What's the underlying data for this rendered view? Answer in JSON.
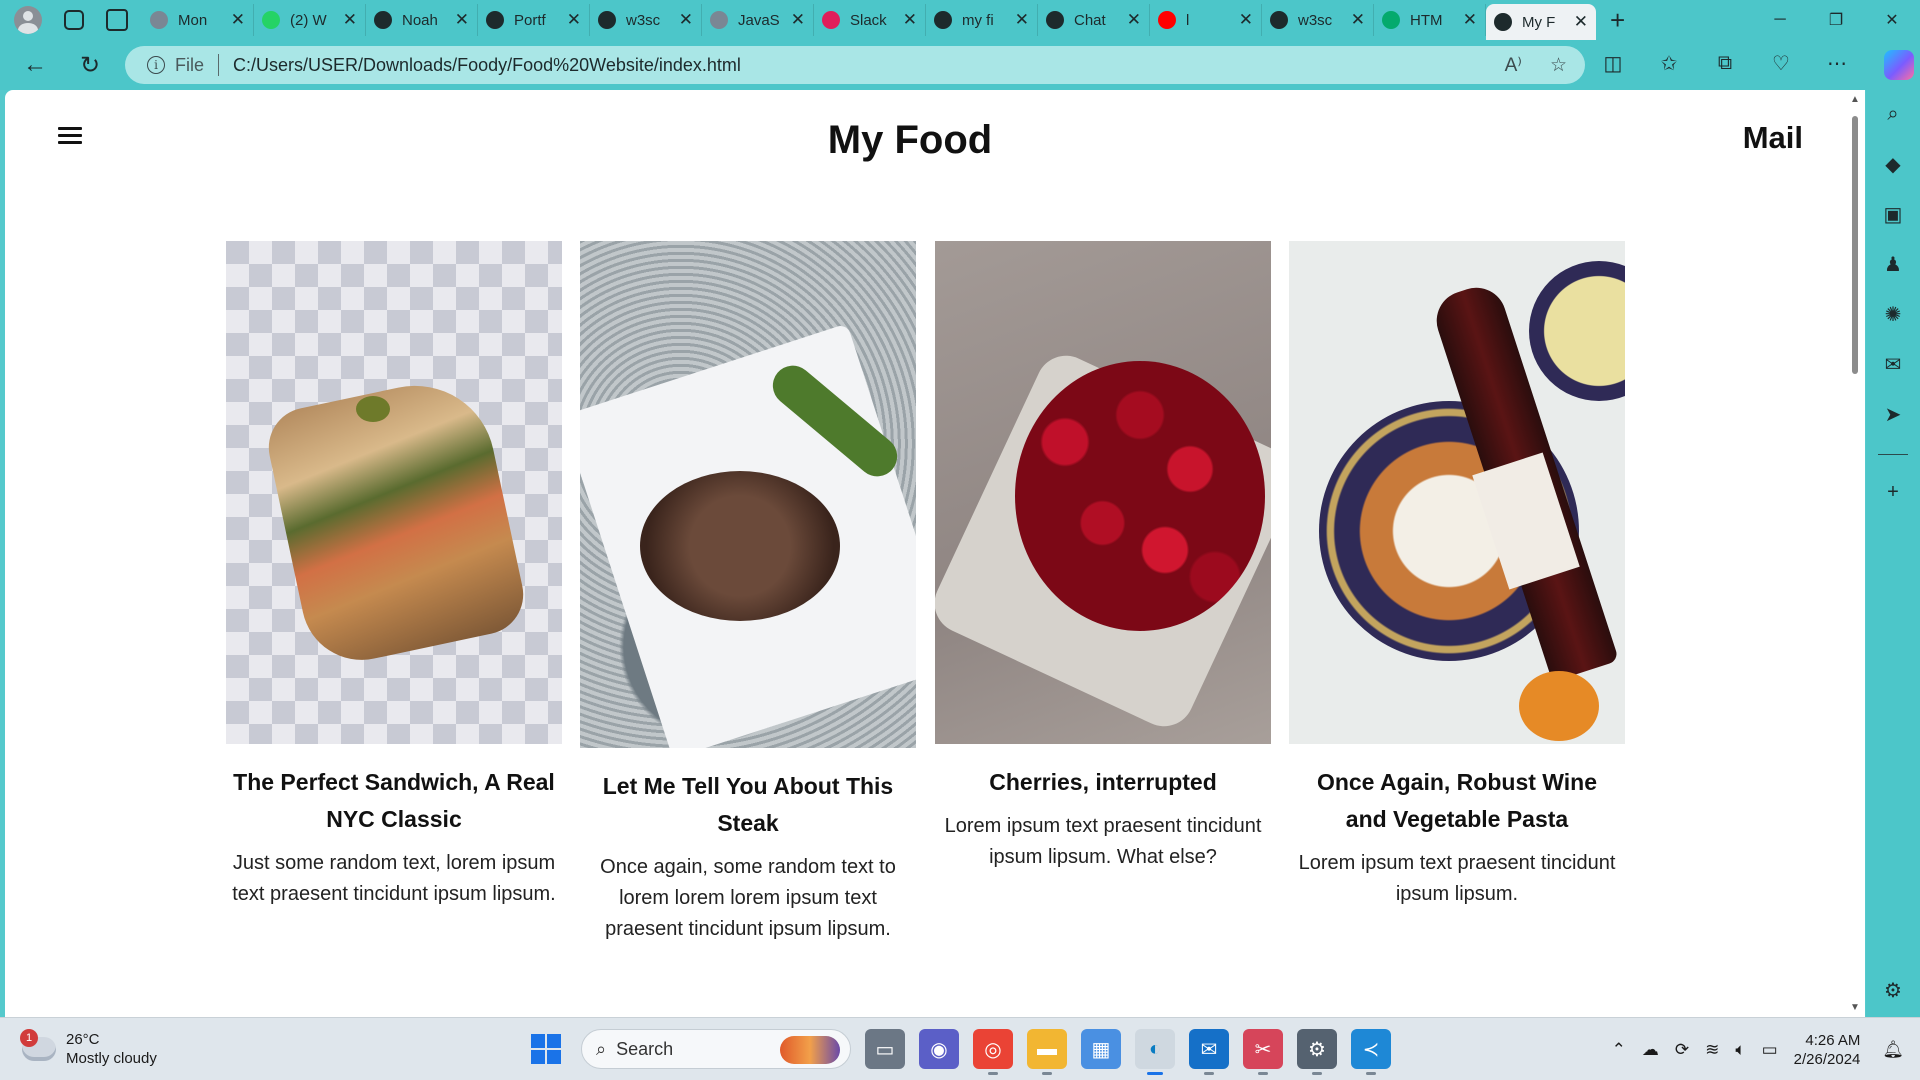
{
  "browser": {
    "tabs": [
      {
        "title": "Mon",
        "icon": "globe-icon",
        "color": "#7a8794"
      },
      {
        "title": "(2) W",
        "icon": "whatsapp-icon",
        "color": "#25d366"
      },
      {
        "title": "Noah",
        "icon": "page-icon",
        "color": "#1d2a2c"
      },
      {
        "title": "Portf",
        "icon": "page-icon",
        "color": "#1d2a2c"
      },
      {
        "title": "w3sc",
        "icon": "search-icon",
        "color": "#1d2a2c"
      },
      {
        "title": "JavaS",
        "icon": "globe-icon",
        "color": "#7a8794"
      },
      {
        "title": "Slack",
        "icon": "slack-icon",
        "color": "#e01e5a"
      },
      {
        "title": "my fi",
        "icon": "github-icon",
        "color": "#1d2a2c"
      },
      {
        "title": "Chat",
        "icon": "chatgpt-icon",
        "color": "#1d2a2c"
      },
      {
        "title": "l",
        "icon": "youtube-icon",
        "color": "#ff0000"
      },
      {
        "title": "w3sc",
        "icon": "search-icon",
        "color": "#1d2a2c"
      },
      {
        "title": "HTM",
        "icon": "w3-icon",
        "color": "#04aa6d"
      },
      {
        "title": "My F",
        "icon": "page-icon",
        "color": "#1d2a2c",
        "active": true
      }
    ],
    "address": {
      "scheme_label": "File",
      "url": "C:/Users/USER/Downloads/Foody/Food%20Website/index.html"
    }
  },
  "page": {
    "title": "My Food",
    "mail_link": "Mail",
    "cards": [
      {
        "heading": "The Perfect Sandwich, A Real NYC Classic",
        "text": "Just some random text, lorem ipsum text praesent tincidunt ipsum lipsum.",
        "image_alt": "sandwich-photo"
      },
      {
        "heading": "Let Me Tell You About This Steak",
        "text": "Once again, some random text to lorem lorem lorem ipsum text praesent tincidunt ipsum lipsum.",
        "image_alt": "steak-photo"
      },
      {
        "heading": "Cherries, interrupted",
        "text": "Lorem ipsum text praesent tincidunt ipsum lipsum. What else?",
        "image_alt": "cherries-photo"
      },
      {
        "heading": "Once Again, Robust Wine and Vegetable Pasta",
        "text": "Lorem ipsum text praesent tincidunt ipsum lipsum.",
        "image_alt": "wine-pasta-photo"
      }
    ]
  },
  "taskbar": {
    "weather": {
      "temp": "26°C",
      "condition": "Mostly cloudy",
      "badge": "1"
    },
    "search_placeholder": "Search",
    "time": "4:26 AM",
    "date": "2/26/2024"
  },
  "colors": {
    "browser_chrome": "#4cc6c9",
    "omnibox": "#a9e6e6",
    "page_bg": "#ffffff",
    "text": "#111111"
  }
}
